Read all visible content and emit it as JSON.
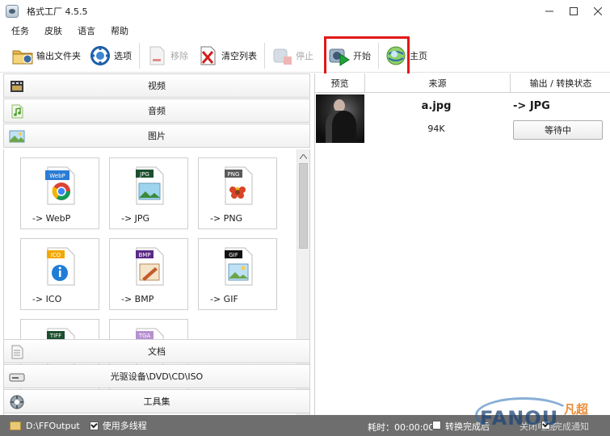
{
  "window": {
    "title": "格式工厂 4.5.5",
    "minimize_icon": "minimize-icon",
    "maximize_icon": "maximize-icon",
    "close_icon": "close-icon"
  },
  "menu": {
    "items": [
      "任务",
      "皮肤",
      "语言",
      "帮助"
    ]
  },
  "toolbar": {
    "output_folder": "输出文件夹",
    "options": "选项",
    "remove": "移除",
    "clear_list": "清空列表",
    "stop": "停止",
    "start": "开始",
    "home": "主页"
  },
  "categories": {
    "video": "视频",
    "audio": "音频",
    "image": "图片",
    "document": "文档",
    "rom": "光驱设备\\DVD\\CD\\ISO",
    "tools": "工具集"
  },
  "formats": [
    {
      "badge": "WebP",
      "label": "-> WebP",
      "color": "#2a7dd6"
    },
    {
      "badge": "JPG",
      "label": "-> JPG",
      "color": "#1d4f2e"
    },
    {
      "badge": "PNG",
      "label": "-> PNG",
      "color": "#5a5a5a"
    },
    {
      "badge": "ICO",
      "label": "-> ICO",
      "color": "#f2a800"
    },
    {
      "badge": "BMP",
      "label": "-> BMP",
      "color": "#5b2a86"
    },
    {
      "badge": "GIF",
      "label": "-> GIF",
      "color": "#111111"
    },
    {
      "badge": "TIFF",
      "label": "",
      "color": "#1d4f2e"
    },
    {
      "badge": "TGA",
      "label": "",
      "color": "#b78fd1"
    }
  ],
  "task_table": {
    "headers": [
      "预览",
      "来源",
      "输出 / 转换状态"
    ],
    "rows": [
      {
        "source": "a.jpg",
        "size": "94K",
        "output": "-> JPG",
        "status": "等待中"
      }
    ]
  },
  "statusbar": {
    "output_path": "D:\\FFOutput",
    "multithread": "使用多线程",
    "elapsed": "耗时：00:00:00",
    "after_convert": "转换完成后",
    "shutdown": "关闭电脑",
    "done_notify": "完成通知"
  },
  "watermark": {
    "text": "FANOU",
    "sub": "凡超"
  },
  "colors": {
    "highlight": "#e21818",
    "statusbar_bg": "#6e6e6e"
  }
}
